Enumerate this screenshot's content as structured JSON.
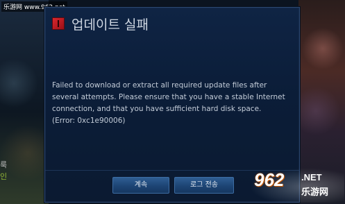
{
  "watermark": {
    "site_top": "乐游网 www.962.net",
    "logo_number": "962",
    "logo_suffix": ".NET",
    "logo_cn": "乐游网"
  },
  "background": {
    "side_text_1": "룩",
    "side_text_2": "인"
  },
  "dialog": {
    "title": "업데이트 실패",
    "icon": "alert-icon",
    "message": "Failed to download or extract all required update files after several attempts. Please ensure that you have a stable Internet connection, and that you have sufficient hard disk space.",
    "error_code": "(Error: 0xc1e90006)",
    "buttons": {
      "continue_label": "계속",
      "send_log_label": "로그 전송"
    }
  },
  "colors": {
    "dialog_bg": "#0f2444",
    "title_text": "#cfd7e2",
    "button_bg": "#1d4474",
    "icon_red": "#d9282f"
  }
}
